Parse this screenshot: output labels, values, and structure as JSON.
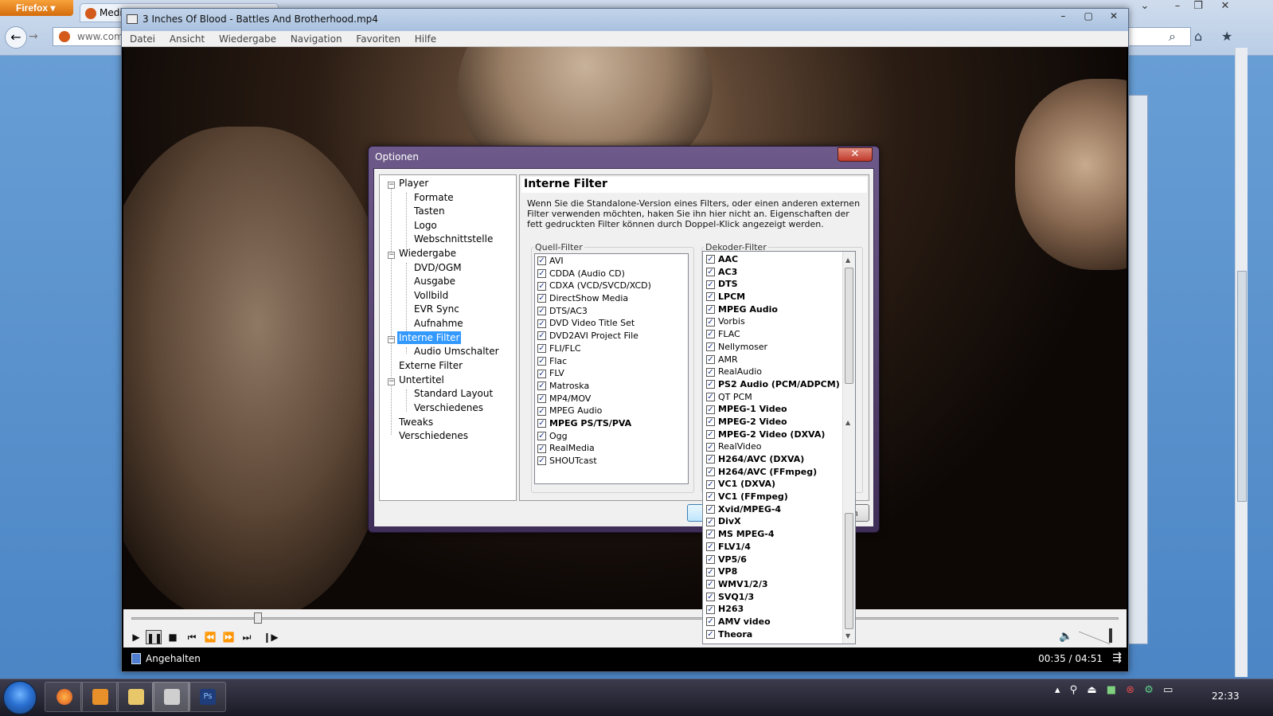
{
  "firefox": {
    "menu_button": "Firefox",
    "tab_title": "Medi",
    "url": "www.com"
  },
  "player": {
    "title": "3 Inches Of Blood - Battles And Brotherhood.mp4",
    "menu": [
      "Datei",
      "Ansicht",
      "Wiedergabe",
      "Navigation",
      "Favoriten",
      "Hilfe"
    ],
    "seek_position": 0.12,
    "status": "Angehalten",
    "time": "00:35 / 04:51"
  },
  "dialog": {
    "title": "Optionen",
    "tree": {
      "player": "Player",
      "formate": "Formate",
      "tasten": "Tasten",
      "logo": "Logo",
      "webschnittstelle": "Webschnittstelle",
      "wiedergabe": "Wiedergabe",
      "dvd_ogm": "DVD/OGM",
      "ausgabe": "Ausgabe",
      "vollbild": "Vollbild",
      "evr_sync": "EVR Sync",
      "aufnahme": "Aufnahme",
      "interne_filter": "Interne Filter",
      "audio_umschalter": "Audio Umschalter",
      "externe_filter": "Externe Filter",
      "untertitel": "Untertitel",
      "standard_layout": "Standard Layout",
      "verschiedenes_sub": "Verschiedenes",
      "tweaks": "Tweaks",
      "verschiedenes": "Verschiedenes"
    },
    "page_title": "Interne Filter",
    "description": "Wenn Sie die Standalone-Version eines Filters, oder einen anderen externen Filter verwenden möchten, haken Sie ihn hier nicht an. Eigenschaften der fett gedruckten Filter können durch Doppel-Klick angezeigt werden.",
    "source_group": "Quell-Filter",
    "decoder_group": "Dekoder-Filter",
    "source_filters": [
      {
        "label": "AVI",
        "bold": false
      },
      {
        "label": "CDDA (Audio CD)",
        "bold": false
      },
      {
        "label": "CDXA (VCD/SVCD/XCD)",
        "bold": false
      },
      {
        "label": "DirectShow Media",
        "bold": false
      },
      {
        "label": "DTS/AC3",
        "bold": false
      },
      {
        "label": "DVD Video Title Set",
        "bold": false
      },
      {
        "label": "DVD2AVI Project File",
        "bold": false
      },
      {
        "label": "FLI/FLC",
        "bold": false
      },
      {
        "label": "Flac",
        "bold": false
      },
      {
        "label": "FLV",
        "bold": false
      },
      {
        "label": "Matroska",
        "bold": false
      },
      {
        "label": "MP4/MOV",
        "bold": false
      },
      {
        "label": "MPEG Audio",
        "bold": false
      },
      {
        "label": "MPEG PS/TS/PVA",
        "bold": true
      },
      {
        "label": "Ogg",
        "bold": false
      },
      {
        "label": "RealMedia",
        "bold": false
      },
      {
        "label": "SHOUTcast",
        "bold": false
      }
    ],
    "decoder_filters": [
      {
        "label": "AAC",
        "bold": true
      },
      {
        "label": "AC3",
        "bold": true
      },
      {
        "label": "DTS",
        "bold": true
      },
      {
        "label": "LPCM",
        "bold": true
      },
      {
        "label": "MPEG Audio",
        "bold": true
      },
      {
        "label": "Vorbis",
        "bold": false
      },
      {
        "label": "FLAC",
        "bold": false
      },
      {
        "label": "Nellymoser",
        "bold": false
      },
      {
        "label": "AMR",
        "bold": false
      },
      {
        "label": "RealAudio",
        "bold": false
      },
      {
        "label": "PS2 Audio (PCM/ADPCM)",
        "bold": true
      },
      {
        "label": "QT PCM",
        "bold": false
      },
      {
        "label": "MPEG-1 Video",
        "bold": true
      },
      {
        "label": "MPEG-2 Video",
        "bold": true
      },
      {
        "label": "MPEG-2 Video (DXVA)",
        "bold": true
      },
      {
        "label": "RealVideo",
        "bold": false
      },
      {
        "label": "H264/AVC (DXVA)",
        "bold": true
      },
      {
        "label": "H264/AVC (FFmpeg)",
        "bold": true
      },
      {
        "label": "VC1 (DXVA)",
        "bold": true
      },
      {
        "label": "VC1 (FFmpeg)",
        "bold": true
      },
      {
        "label": "Xvid/MPEG-4",
        "bold": true
      },
      {
        "label": "DivX",
        "bold": true
      },
      {
        "label": "MS MPEG-4",
        "bold": true
      },
      {
        "label": "FLV1/4",
        "bold": true
      },
      {
        "label": "VP5/6",
        "bold": true
      },
      {
        "label": "VP8",
        "bold": true
      },
      {
        "label": "WMV1/2/3",
        "bold": true
      },
      {
        "label": "SVQ1/3",
        "bold": true
      },
      {
        "label": "H263",
        "bold": true
      },
      {
        "label": "AMV video",
        "bold": true
      },
      {
        "label": "Theora",
        "bold": true
      }
    ],
    "cancel_partial": "en"
  },
  "taskbar": {
    "clock": "22:33"
  },
  "colors": {
    "selection": "#3399ff",
    "dialog_frame": "#4e3c68",
    "taskbar": "#24243a"
  }
}
